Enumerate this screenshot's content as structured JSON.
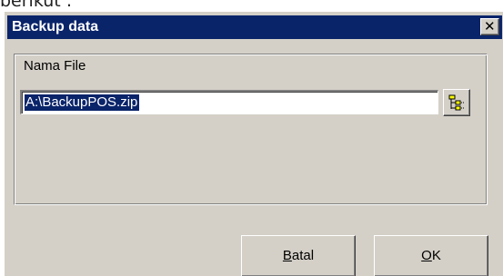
{
  "page_fragment": "berikut :",
  "dialog": {
    "title": "Backup data",
    "close_glyph": "✕",
    "close_icon": "close-icon",
    "field": {
      "label": "Nama File",
      "value": "A:\\BackupPOS.zip"
    },
    "browse": {
      "icon": "folder-tree-icon"
    },
    "buttons": {
      "cancel": {
        "first": "B",
        "rest": "atal"
      },
      "ok": {
        "first": "O",
        "rest": "K"
      }
    }
  },
  "colors": {
    "titlebar": "#0a246a",
    "face": "#d4d0c8",
    "selection": "#0a246a",
    "icon_yellow": "#ffff00"
  }
}
